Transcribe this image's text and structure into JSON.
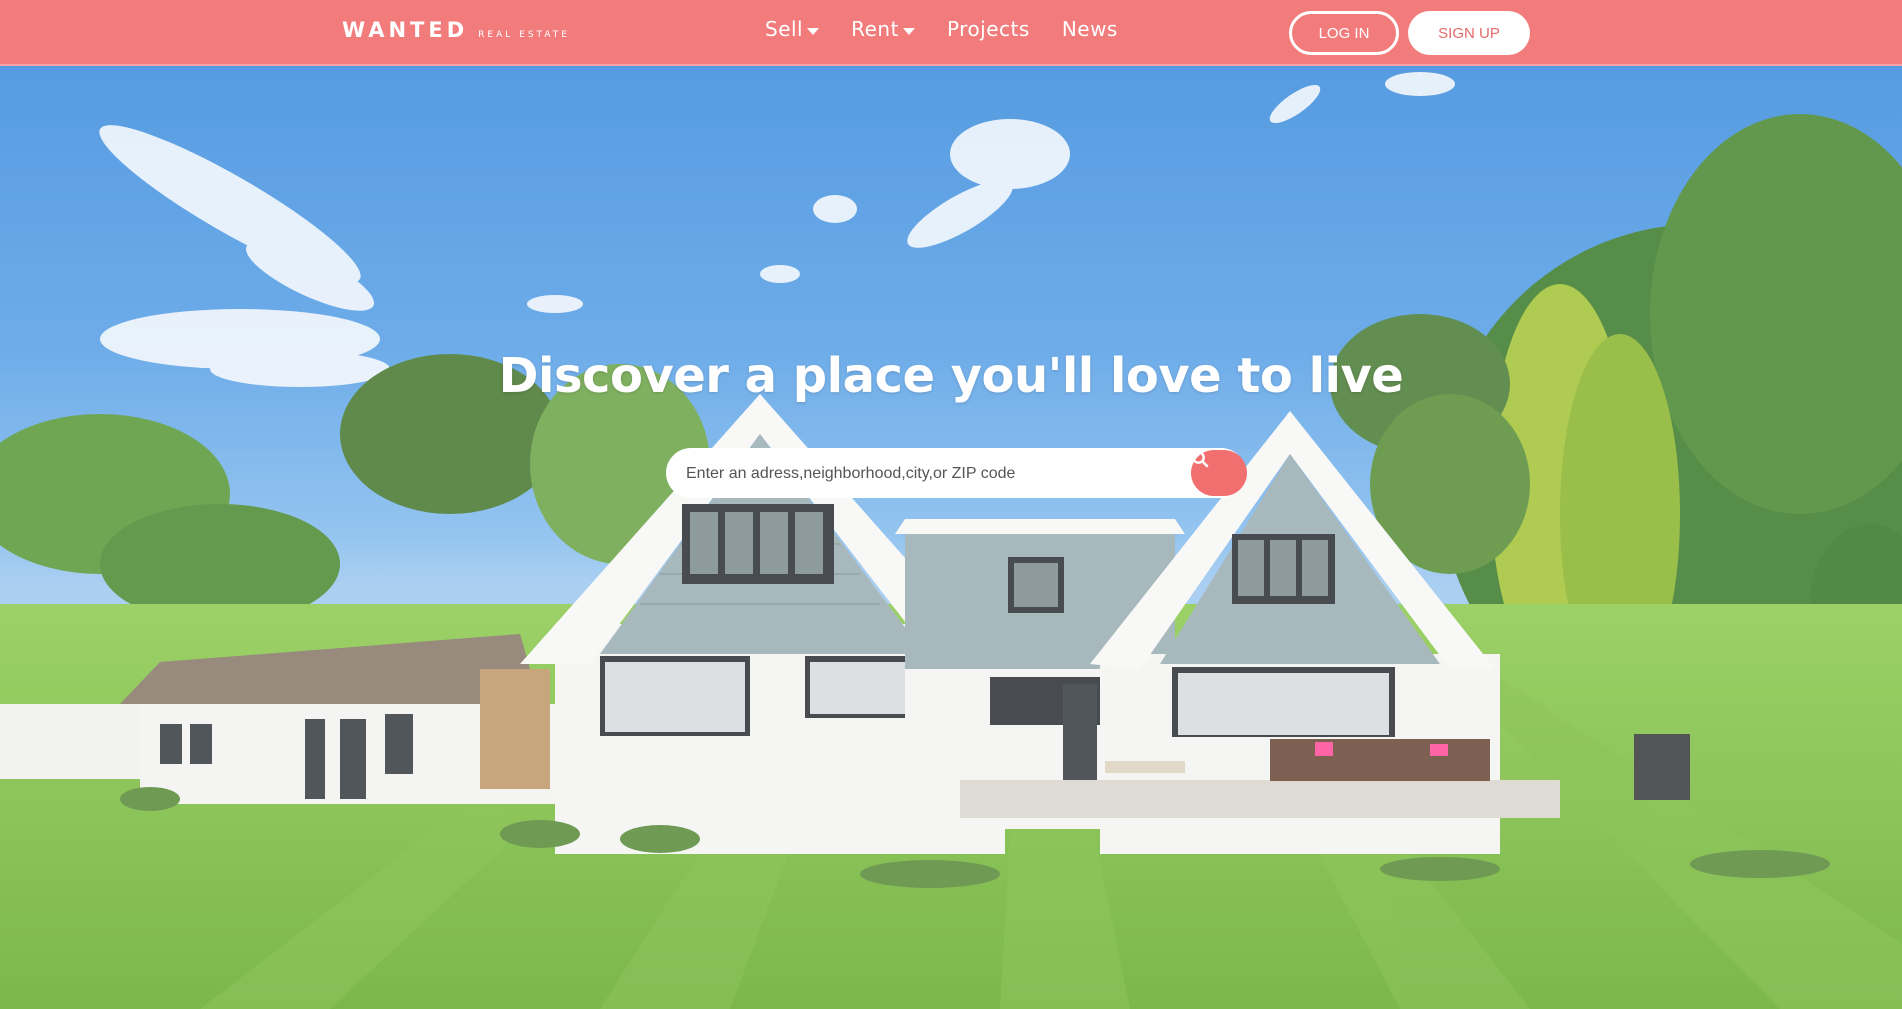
{
  "brand": {
    "name": "WANTED",
    "tagline": "REAL ESTATE"
  },
  "nav": {
    "items": [
      {
        "label": "Sell",
        "dropdown": true
      },
      {
        "label": "Rent",
        "dropdown": true
      },
      {
        "label": "Projects",
        "dropdown": false
      },
      {
        "label": "News",
        "dropdown": false
      }
    ],
    "login_label": "LOG IN",
    "signup_label": "SIGN UP"
  },
  "hero": {
    "title": "Discover a place you'll love to live",
    "search_placeholder": "Enter an adress,neighborhood,city,or ZIP code",
    "search_icon": "search-icon"
  },
  "colors": {
    "accent": "#f27c7c",
    "search_button": "#f26f6f",
    "white": "#ffffff"
  }
}
